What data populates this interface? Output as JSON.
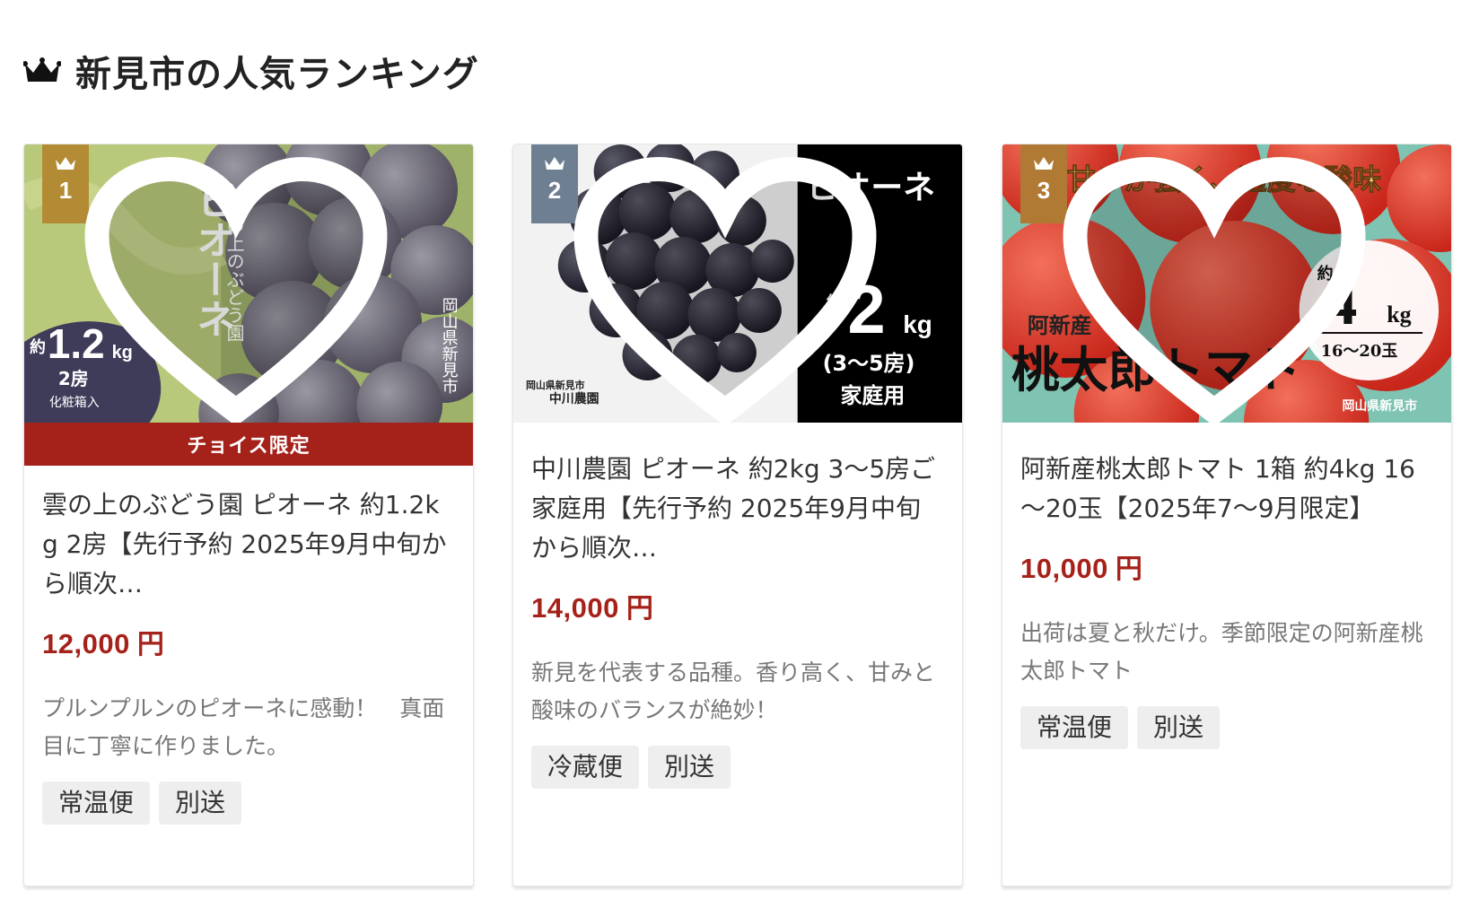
{
  "heading": {
    "title": "新見市の人気ランキング",
    "icon": "crown-icon"
  },
  "cards": [
    {
      "rank": "1",
      "rank_color": "#b38b34",
      "badge": "チョイス限定",
      "image_text": {
        "vertical_main": "ピオーネ",
        "vertical_sub": "雲の上のぶどう園",
        "vertical_place": "岡山県新見市",
        "weight_prefix": "約",
        "weight_num": "1.2",
        "weight_unit": "kg",
        "count": "2房",
        "box": "化粧箱入"
      },
      "title": "雲の上のぶどう園 ピオーネ 約1.2kg 2房【先行予約 2025年9月中旬から順次…",
      "price": "12,000",
      "price_unit": "円",
      "description": "プルンプルンのピオーネに感動！　真面目に丁寧に作りました。",
      "tags": [
        "常温便",
        "別送"
      ]
    },
    {
      "rank": "2",
      "rank_color": "#6f7f92",
      "image_text": {
        "name": "ピオーネ",
        "weight_prefix": "約",
        "weight_num": "2",
        "weight_unit": "kg",
        "count": "(3～5房)",
        "type": "家庭用",
        "place": "岡山県新見市",
        "farm": "中川農園"
      },
      "title": "中川農園 ピオーネ 約2kg 3～5房ご家庭用【先行予約 2025年9月中旬から順次…",
      "price": "14,000",
      "price_unit": "円",
      "description": "新見を代表する品種。香り高く、甘みと酸味のバランスが絶妙！",
      "tags": [
        "冷蔵便",
        "別送"
      ]
    },
    {
      "rank": "3",
      "rank_color": "#b07a34",
      "image_text": {
        "banner": "甘みが強く、適度な酸味",
        "origin": "阿新産",
        "name": "桃太郎トマト",
        "weight_prefix": "約",
        "weight_num": "4",
        "weight_unit": "kg",
        "count": "16～20玉",
        "place": "岡山県新見市"
      },
      "title": "阿新産桃太郎トマト 1箱 約4kg 16～20玉【2025年7～9月限定】",
      "price": "10,000",
      "price_unit": "円",
      "description": "出荷は夏と秋だけ。季節限定の阿新産桃太郎トマト",
      "tags": [
        "常温便",
        "別送"
      ]
    }
  ]
}
